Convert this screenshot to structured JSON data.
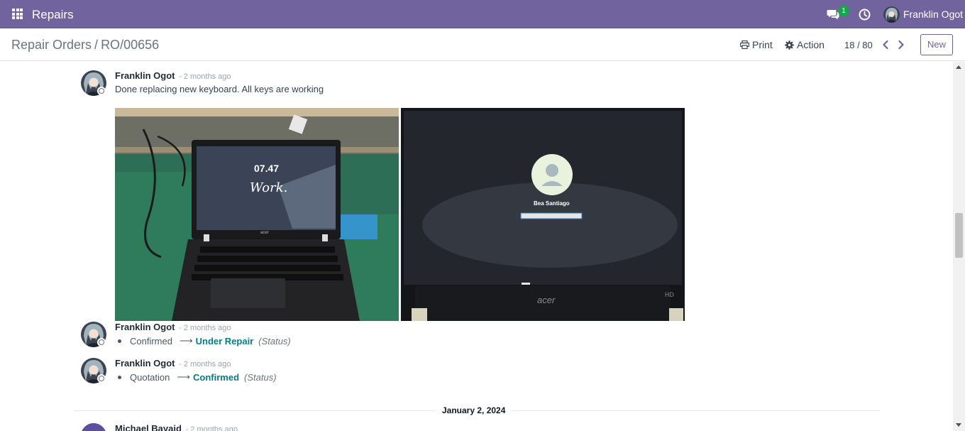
{
  "navbar": {
    "app_name": "Repairs",
    "messages_badge": "1",
    "user_name": "Franklin Ogot",
    "colors": {
      "navbar_bg": "#71639e",
      "badge": "#17a54b"
    }
  },
  "control_panel": {
    "breadcrumb_parent": "Repair Orders",
    "breadcrumb_separator": "/",
    "breadcrumb_current": "RO/00656",
    "print_label": "Print",
    "action_label": "Action",
    "pager": "18 / 80",
    "new_label": "New"
  },
  "chatter": {
    "messages": [
      {
        "author": "Franklin Ogot",
        "time": "- 2 months ago",
        "body": "Done replacing new keyboard. All keys are working",
        "attachments": [
          {
            "name": "laptop-lockscreen-photo",
            "screen_time": "07.47",
            "screen_text": "Work.",
            "brand": "acer"
          },
          {
            "name": "laptop-login-photo",
            "screen_user": "Bea Santiago",
            "brand": "acer"
          }
        ]
      },
      {
        "author": "Franklin Ogot",
        "time": "- 2 months ago",
        "old_value": "Confirmed",
        "new_value": "Under Repair",
        "field": "(Status)"
      },
      {
        "author": "Franklin Ogot",
        "time": "- 2 months ago",
        "old_value": "Quotation",
        "new_value": "Confirmed",
        "field": "(Status)"
      },
      {
        "author": "Michael Bayaid",
        "time": "- 2 months ago"
      }
    ],
    "date_separator": "January 2, 2024"
  }
}
